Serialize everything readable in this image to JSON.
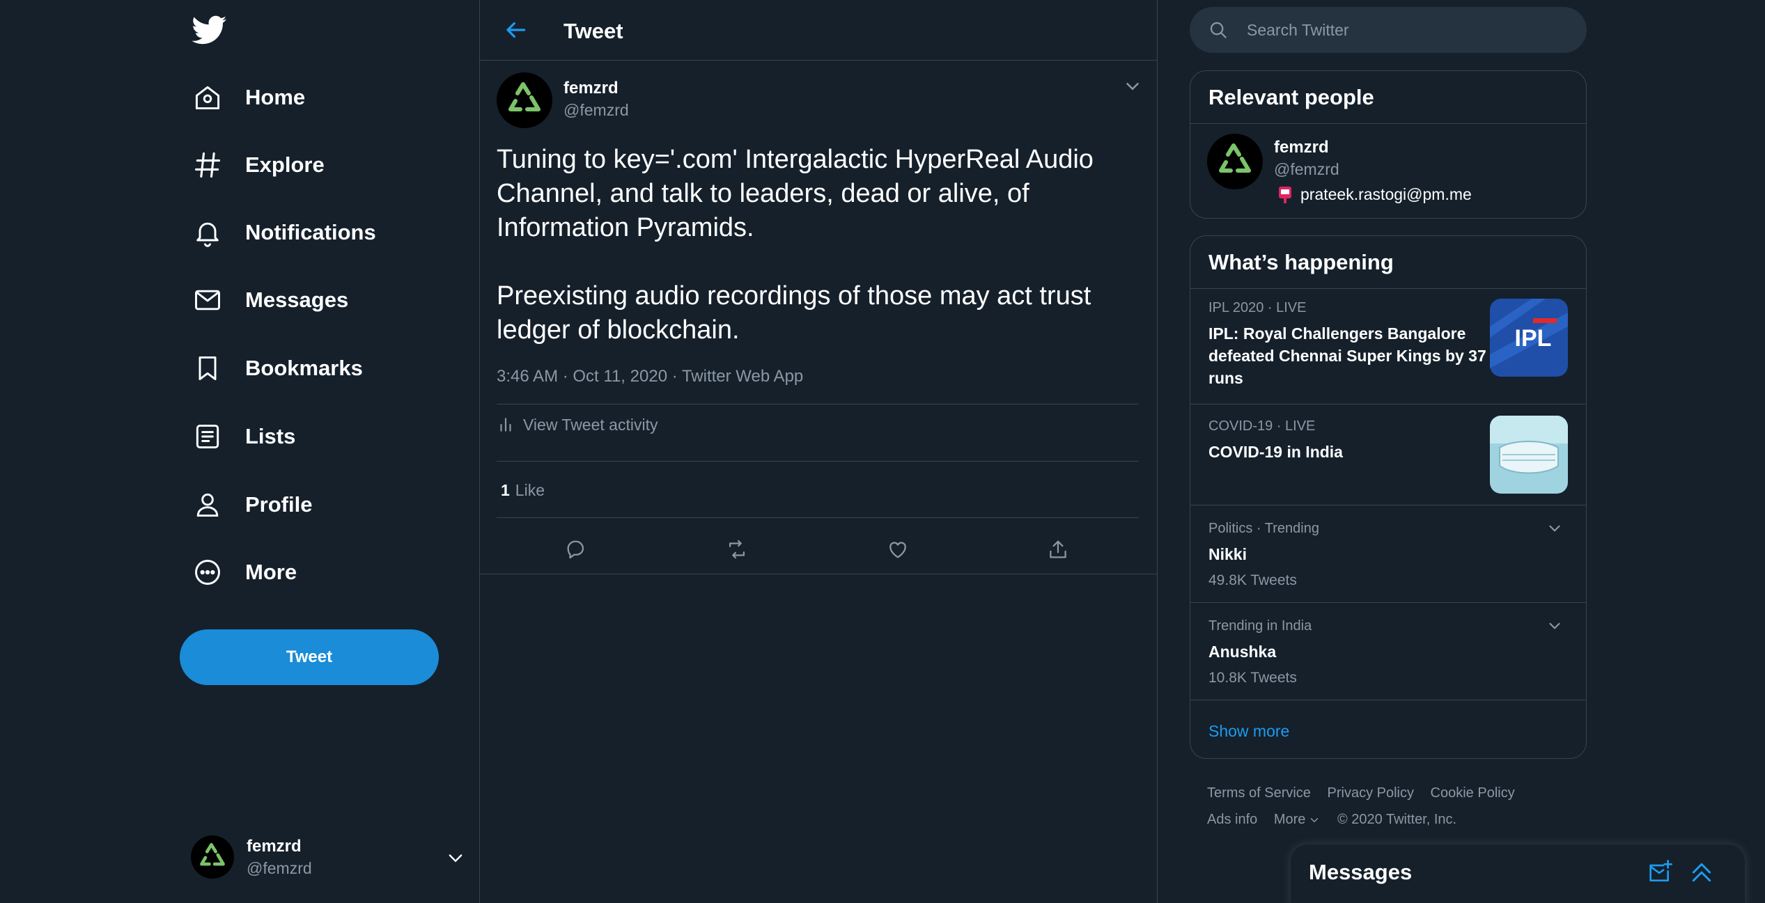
{
  "colors": {
    "background": "#15202b",
    "border": "#38444d",
    "accent": "#1d9bf0",
    "muted_text": "#8b98a5",
    "tweet_button": "#1a8cd8"
  },
  "nav": {
    "logo_icon": "twitter-bird-icon",
    "items": [
      {
        "label": "Home",
        "icon": "home-icon"
      },
      {
        "label": "Explore",
        "icon": "hashtag-icon"
      },
      {
        "label": "Notifications",
        "icon": "bell-icon"
      },
      {
        "label": "Messages",
        "icon": "envelope-icon"
      },
      {
        "label": "Bookmarks",
        "icon": "bookmark-icon"
      },
      {
        "label": "Lists",
        "icon": "list-icon"
      },
      {
        "label": "Profile",
        "icon": "person-icon"
      },
      {
        "label": "More",
        "icon": "more-circle-icon"
      }
    ],
    "tweet_button": "Tweet",
    "account": {
      "name": "femzrd",
      "handle": "@femzrd"
    }
  },
  "main": {
    "title": "Tweet",
    "tweet": {
      "author_name": "femzrd",
      "author_handle": "@femzrd",
      "text": "Tuning to key='.com' Intergalactic HyperReal Audio\nChannel, and talk to leaders, dead or alive, of\nInformation Pyramids.\n\nPreexisting audio recordings of those may act trust\nledger of blockchain.",
      "time": "3:46 AM",
      "date": "Oct 11, 2020",
      "source": "Twitter Web App",
      "activity_label": "View Tweet activity",
      "like_count": "1",
      "like_label": "Like"
    }
  },
  "search": {
    "placeholder": "Search Twitter"
  },
  "relevant_people": {
    "title": "Relevant people",
    "person": {
      "name": "femzrd",
      "handle": "@femzrd",
      "bio": "prateek.rastogi@pm.me"
    }
  },
  "happening": {
    "title": "What’s happening",
    "trends": [
      {
        "meta": "IPL 2020 · LIVE",
        "title": "IPL: Royal Challengers Bangalore defeated Chennai Super Kings by 37 runs",
        "thumb": "ipl-logo-image"
      },
      {
        "meta": "COVID-19 · LIVE",
        "title": "COVID-19 in India",
        "thumb": "face-mask-image"
      },
      {
        "meta": "Politics · Trending",
        "title": "Nikki",
        "count": "49.8K Tweets"
      },
      {
        "meta": "Trending in India",
        "title": "Anushka",
        "count": "10.8K Tweets"
      }
    ],
    "show_more": "Show more"
  },
  "footer": {
    "links": [
      "Terms of Service",
      "Privacy Policy",
      "Cookie Policy",
      "Ads info",
      "More"
    ],
    "copyright": "© 2020 Twitter, Inc."
  },
  "messages_drawer": {
    "title": "Messages"
  }
}
